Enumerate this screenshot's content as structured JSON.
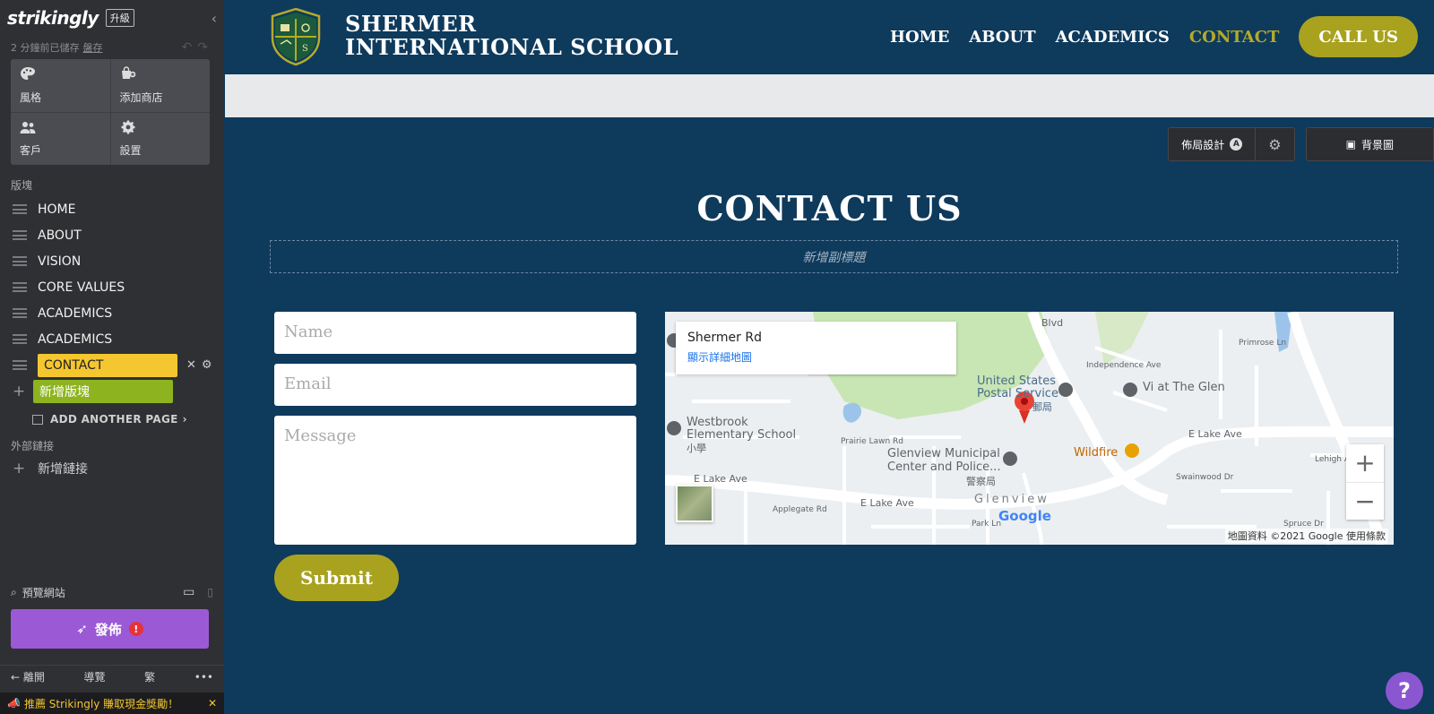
{
  "sidebar": {
    "logo": "strikingly",
    "upgrade": "升級",
    "saved_status": "2 分鐘前已儲存",
    "drafts_link": "盤存",
    "tiles": [
      {
        "icon": "palette-icon",
        "label": "風格"
      },
      {
        "icon": "add-store-icon",
        "label": "添加商店"
      },
      {
        "icon": "users-icon",
        "label": "客戶"
      },
      {
        "icon": "gear-icon",
        "label": "設置"
      }
    ],
    "sections_label": "版塊",
    "sections": [
      "HOME",
      "ABOUT",
      "VISION",
      "CORE VALUES",
      "ACADEMICS",
      "ACADEMICS"
    ],
    "active_section": "CONTACT",
    "add_section": "新增版塊",
    "add_page": "ADD ANOTHER PAGE",
    "external_label": "外部鏈接",
    "add_link": "新增鏈接",
    "preview": "預覽網站",
    "publish": "發佈",
    "bottom_nav": [
      "離開",
      "導覽",
      "繁",
      "•••"
    ],
    "promo": "推薦 Strikingly 賺取現金獎勵！"
  },
  "site": {
    "school_line1": "SHERMER",
    "school_line2": "INTERNATIONAL SCHOOL",
    "nav": [
      "HOME",
      "ABOUT",
      "ACADEMICS",
      "CONTACT"
    ],
    "nav_active": "CONTACT",
    "call_us": "CALL US",
    "toolbar": {
      "layout": "佈局設計",
      "layout_badge": "A",
      "background": "背景圖"
    },
    "title": "CONTACT US",
    "subtitle_placeholder": "新增副標題",
    "form": {
      "name_placeholder": "Name",
      "email_placeholder": "Email",
      "message_placeholder": "Message",
      "submit": "Submit"
    },
    "map": {
      "card_title": "Shermer Rd",
      "card_link": "顯示詳細地圖",
      "labels": {
        "usps_1": "United States",
        "usps_2": "Postal Service",
        "usps_3": "郵局",
        "glen": "Vi at The Glen",
        "westbrook_1": "Westbrook",
        "westbrook_2": "Elementary School",
        "westbrook_3": "小學",
        "municipal_1": "Glenview Municipal",
        "municipal_2": "Center and Police...",
        "municipal_3": "警察局",
        "wildfire": "Wildfire",
        "e_lake_ave_1": "E Lake Ave",
        "e_lake_ave_2": "E Lake Ave",
        "e_lake_ave_3": "E Lake Ave",
        "glenview": "Glenview",
        "prairie": "Prairie Lawn Rd",
        "applegate": "Applegate Rd",
        "park_ln": "Park Ln",
        "swainwood": "Swainwood Dr",
        "independence": "Independence Ave",
        "primrose": "Primrose Ln",
        "lehigh": "Lehigh Ave",
        "spruce": "Spruce Dr",
        "blvd": "Blvd"
      },
      "google": "Google",
      "footer": "地圖資料 ©2021 Google    使用條款"
    },
    "help": "?"
  },
  "colors": {
    "navy": "#0e3a5c",
    "olive": "#a9a21f",
    "sidebar": "#2f3033",
    "active_section": "#f4c62f",
    "add_section": "#8db41f",
    "publish": "#9b59d6"
  }
}
